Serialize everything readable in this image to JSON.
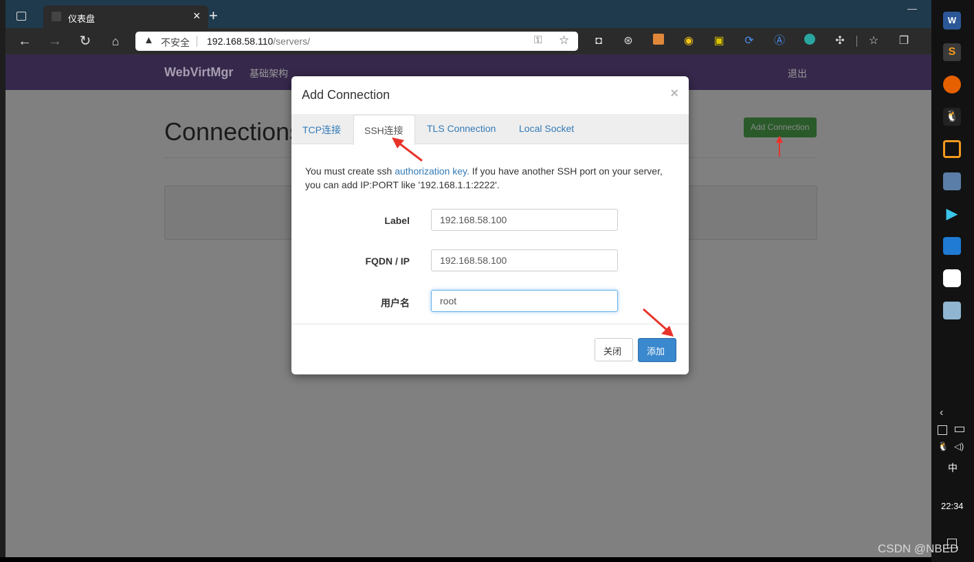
{
  "browser": {
    "tab_title": "仪表盘",
    "close_tab": "×",
    "new_tab": "+",
    "insecure_label": "不安全",
    "url_host": "192.168.58.110",
    "url_path": "/servers/",
    "minimize": "—"
  },
  "site": {
    "brand": "WebVirtMgr",
    "nav_infra": "基础架构",
    "logout": "退出",
    "page_heading": "Connections",
    "add_connection_button": "Add Connection"
  },
  "modal": {
    "title": "Add Connection",
    "close_x": "×",
    "tabs": [
      {
        "label": "TCP连接"
      },
      {
        "label": "SSH连接"
      },
      {
        "label": "TLS Connection"
      },
      {
        "label": "Local Socket"
      }
    ],
    "info_before_link": "You must create ssh ",
    "info_link": "authorization key.",
    "info_after_link": " If you have another SSH port on your server, you can add IP:PORT like '192.168.1.1:2222'.",
    "fields": {
      "label": {
        "label": "Label",
        "value": "192.168.58.100"
      },
      "fqdn": {
        "label": "FQDN / IP",
        "value": "192.168.58.100"
      },
      "user": {
        "label": "用户名",
        "value": "root"
      }
    },
    "close_button": "关闭",
    "add_button": "添加"
  },
  "system": {
    "ime": "中",
    "clock": "22:34"
  },
  "watermark": "CSDN @NBED",
  "colors": {
    "navbar": "#36284b",
    "primary": "#3a88cd",
    "success": "#449d44",
    "annotation_arrow": "#e8332b"
  }
}
